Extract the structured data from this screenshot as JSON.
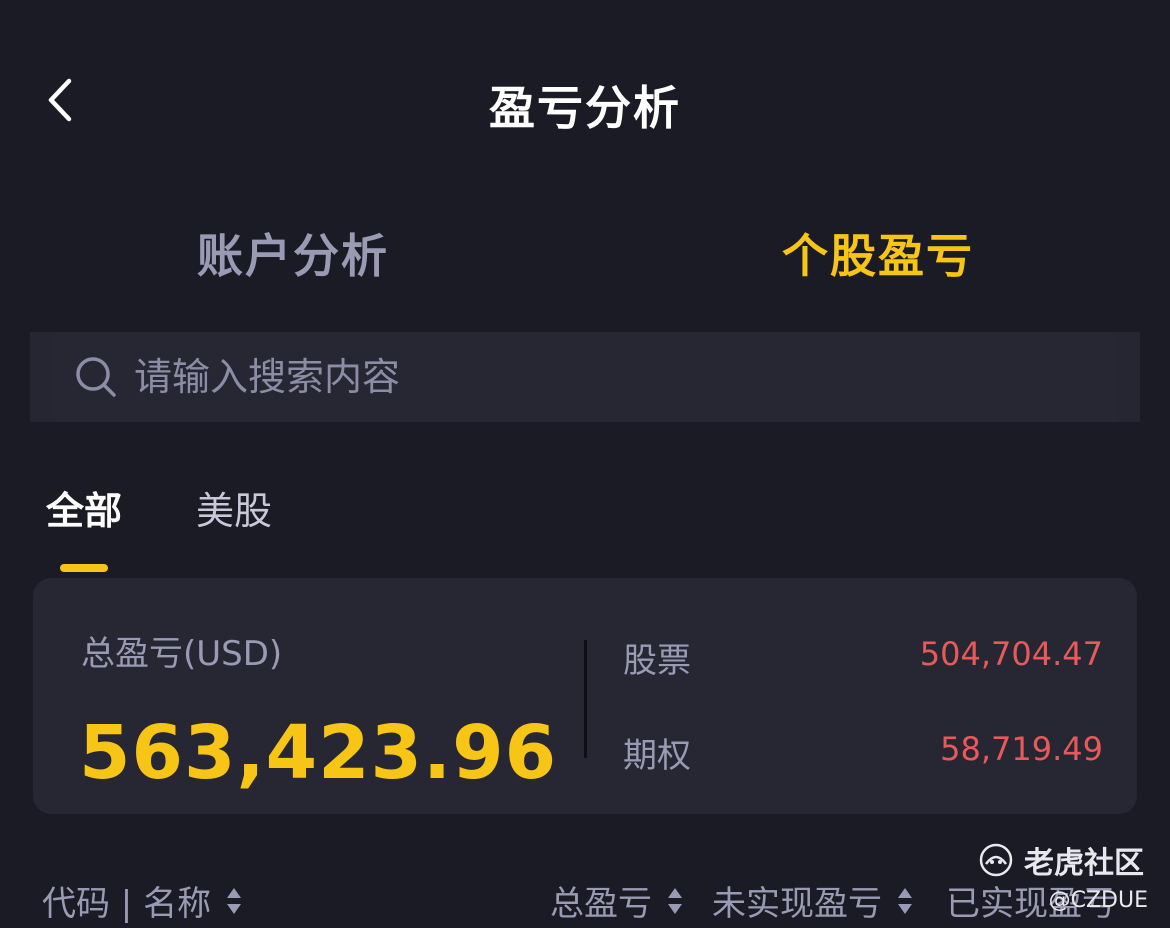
{
  "header": {
    "title": "盈亏分析"
  },
  "main_tabs": [
    {
      "label": "账户分析",
      "active": false
    },
    {
      "label": "个股盈亏",
      "active": true
    }
  ],
  "search": {
    "placeholder": "请输入搜索内容",
    "value": ""
  },
  "sub_tabs": [
    {
      "label": "全部",
      "active": true
    },
    {
      "label": "美股",
      "active": false
    }
  ],
  "summary": {
    "total_label": "总盈亏(USD)",
    "total_value": "563,423.96",
    "breakdown": [
      {
        "label": "股票",
        "value": "504,704.47"
      },
      {
        "label": "期权",
        "value": "58,719.49"
      }
    ]
  },
  "columns": [
    {
      "label": "代码 | 名称"
    },
    {
      "label": "总盈亏"
    },
    {
      "label": "未实现盈亏"
    },
    {
      "label": "已实现盈亏"
    }
  ],
  "watermark": {
    "brand": "老虎社区",
    "user": "@CZDUE"
  },
  "colors": {
    "background": "#1b1b25",
    "accent": "#f7c516",
    "positive": "#e85a5a",
    "muted": "#9a9ab4",
    "card": "#272733"
  },
  "icons": [
    "back-arrow-icon",
    "search-icon",
    "sort-icon",
    "tiger-logo-icon"
  ]
}
